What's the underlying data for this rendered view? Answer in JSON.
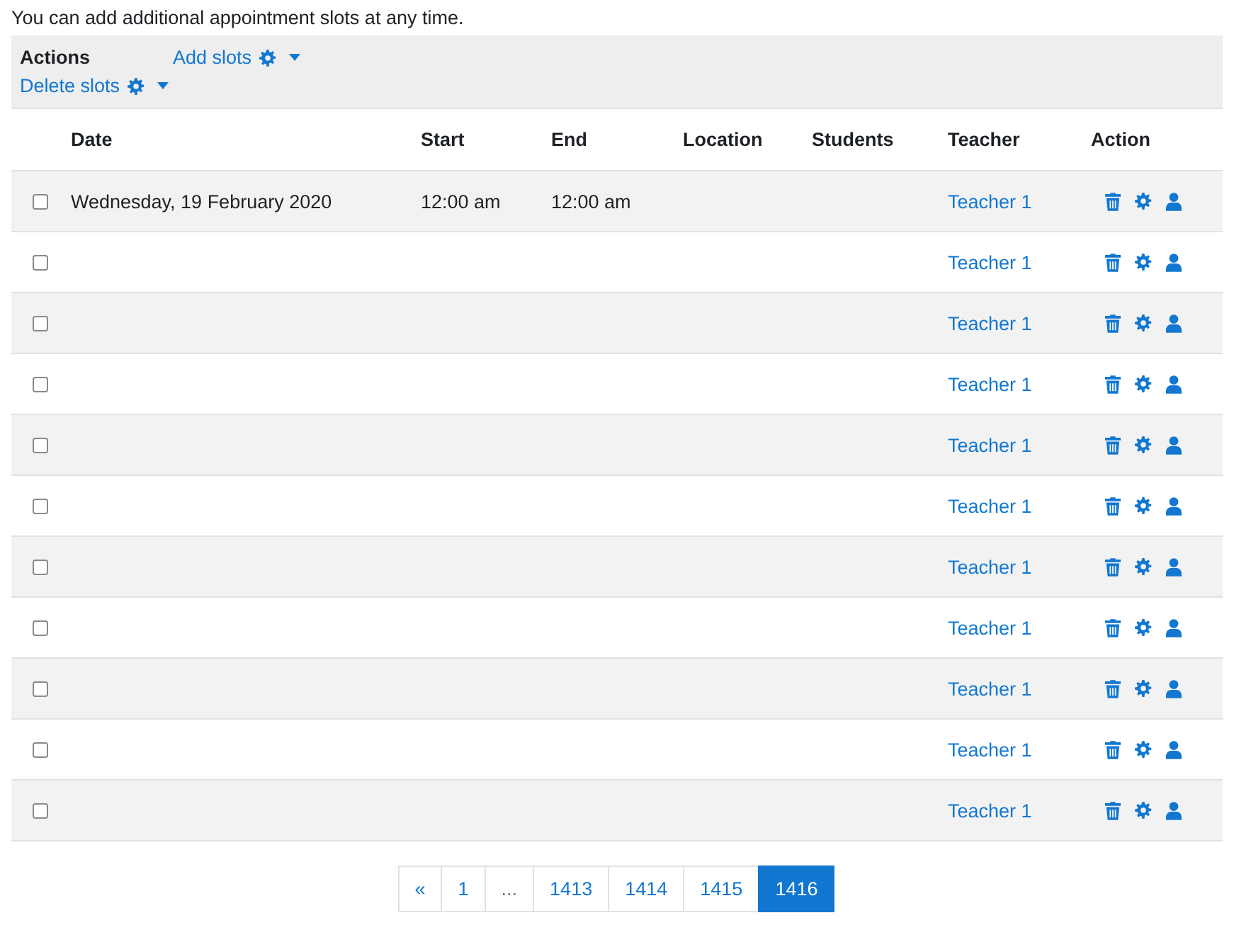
{
  "intro": "You can add additional appointment slots at any time.",
  "actions": {
    "title": "Actions",
    "menus": [
      {
        "label": "Add slots"
      },
      {
        "label": "Delete slots"
      }
    ]
  },
  "table": {
    "columns": [
      "Date",
      "Start",
      "End",
      "Location",
      "Students",
      "Teacher",
      "Action"
    ],
    "rows": [
      {
        "checked": false,
        "date": "Wednesday, 19 February 2020",
        "start": "12:00 am",
        "end": "12:00 am",
        "teacher": "Teacher 1"
      },
      {
        "checked": false,
        "teacher": "Teacher 1"
      },
      {
        "checked": false,
        "teacher": "Teacher 1"
      },
      {
        "checked": false,
        "teacher": "Teacher 1"
      },
      {
        "checked": false,
        "teacher": "Teacher 1"
      },
      {
        "checked": false,
        "teacher": "Teacher 1"
      },
      {
        "checked": false,
        "teacher": "Teacher 1"
      },
      {
        "checked": false,
        "teacher": "Teacher 1"
      },
      {
        "checked": false,
        "teacher": "Teacher 1"
      },
      {
        "checked": false,
        "teacher": "Teacher 1"
      },
      {
        "checked": false,
        "teacher": "Teacher 1"
      }
    ]
  },
  "pagination": [
    {
      "kind": "link",
      "label": "«",
      "selected": false
    },
    {
      "kind": "link",
      "label": "1",
      "selected": false
    },
    {
      "kind": "ellipsis",
      "label": "...",
      "selected": false
    },
    {
      "kind": "link",
      "label": "1413",
      "selected": false
    },
    {
      "kind": "link",
      "label": "1414",
      "selected": false
    },
    {
      "kind": "link",
      "label": "1415",
      "selected": false
    },
    {
      "kind": "link",
      "label": "1416",
      "selected": true
    }
  ]
}
